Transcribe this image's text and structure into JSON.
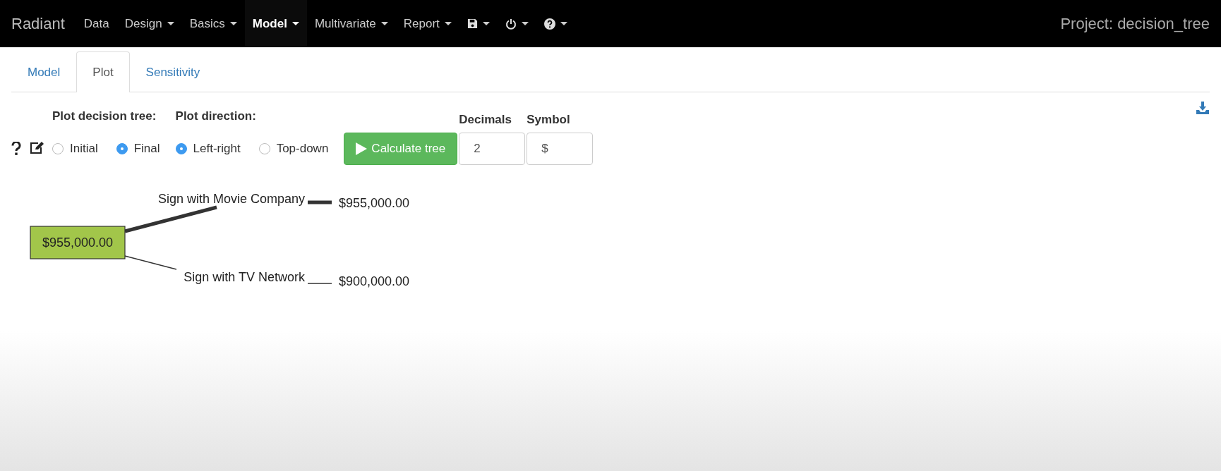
{
  "navbar": {
    "brand": "Radiant",
    "menus": [
      {
        "label": "Data",
        "dropdown": false,
        "selected": false
      },
      {
        "label": "Design",
        "dropdown": true,
        "selected": false
      },
      {
        "label": "Basics",
        "dropdown": true,
        "selected": false
      },
      {
        "label": "Model",
        "dropdown": true,
        "selected": true
      },
      {
        "label": "Multivariate",
        "dropdown": true,
        "selected": false
      },
      {
        "label": "Report",
        "dropdown": true,
        "selected": false
      }
    ],
    "project": "Project: decision_tree"
  },
  "tabs": [
    {
      "label": "Model",
      "selected": false
    },
    {
      "label": "Plot",
      "selected": true
    },
    {
      "label": "Sensitivity",
      "selected": false
    }
  ],
  "controls": {
    "radio_groups": [
      {
        "title": "Plot decision tree:",
        "options": [
          {
            "label": "Initial",
            "selected": false
          },
          {
            "label": "Final",
            "selected": true
          }
        ]
      },
      {
        "title": "Plot direction:",
        "options": [
          {
            "label": "Left-right",
            "selected": true
          },
          {
            "label": "Top-down",
            "selected": false
          }
        ]
      }
    ],
    "calculate_button": "Calculate tree",
    "fields": [
      {
        "label": "Decimals",
        "value": "2"
      },
      {
        "label": "Symbol",
        "value": "$"
      }
    ]
  },
  "tree": {
    "root_value": "$955,000.00",
    "branches": [
      {
        "label": "Sign with Movie Company",
        "value": "$955,000.00",
        "chosen": true
      },
      {
        "label": "Sign with TV Network",
        "value": "$900,000.00",
        "chosen": false
      }
    ]
  }
}
